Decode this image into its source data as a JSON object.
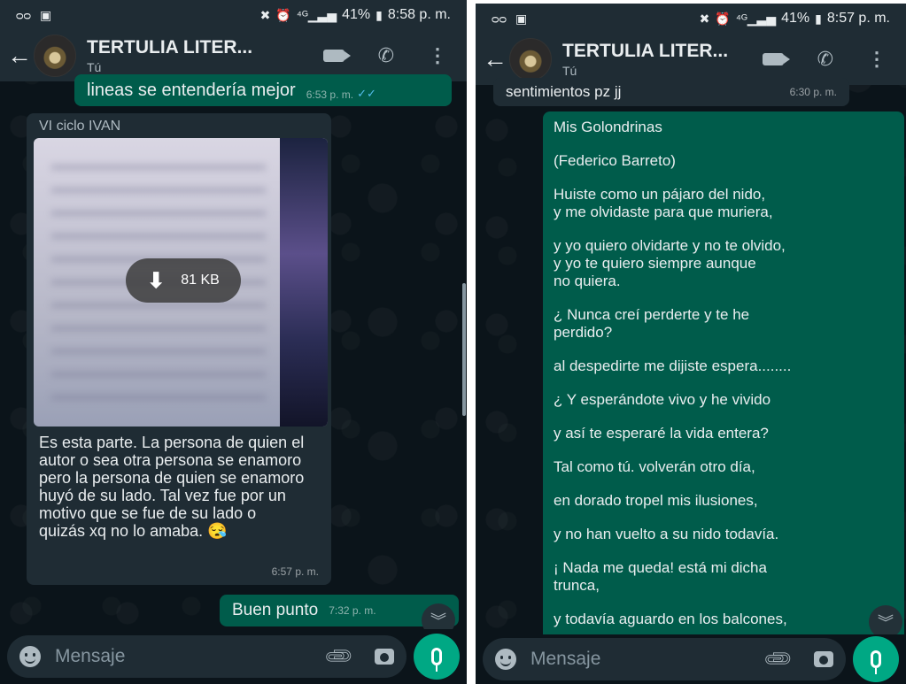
{
  "left": {
    "status": {
      "right_text": "41%",
      "time": "8:58 p. m."
    },
    "header": {
      "title": "TERTULIA LITER...",
      "subtitle": "Tú"
    },
    "messages": {
      "top_out": {
        "text": "lineas se entendería mejor",
        "time": "6:53 p. m."
      },
      "media_msg": {
        "sender": "VI ciclo IVAN",
        "download_size": "81 KB",
        "caption": "Es esta parte. La persona de quien el autor o sea otra persona se enamoro pero la persona de quien se enamoro huyó de su lado. Tal vez fue por un motivo que se fue de su lado o quizás xq no lo amaba. 😪",
        "time": "6:57 p. m."
      },
      "bottom_out": {
        "text": "Buen punto",
        "time": "7:32 p. m."
      }
    },
    "composer": {
      "placeholder": "Mensaje"
    }
  },
  "right": {
    "status": {
      "right_text": "41%",
      "time": "8:57 p. m."
    },
    "header": {
      "title": "TERTULIA LITER...",
      "subtitle": "Tú"
    },
    "messages": {
      "top_in": {
        "text": "sentimientos pz jj",
        "time": "6:30 p. m."
      },
      "poem_lines": [
        "Mis Golondrinas",
        "(Federico Barreto)",
        "Huiste como un pájaro del nido,\ny me olvidaste para que muriera,",
        "y yo quiero olvidarte y no te olvido,\ny yo te quiero siempre aunque\nno quiera.",
        "¿ Nunca creí perderte y te he\nperdido?",
        "al despedirte me dijiste espera........",
        "¿ Y esperándote vivo y he vivido",
        " y así te esperaré la vida entera?",
        "Tal como tú. volverán otro día,",
        "en dorado tropel mis ilusiones,",
        "y no han vuelto a su nido todavía.",
        "¡ Nada me queda! está mi dicha\ntrunca,",
        "y todavía aguardo en los balcones,"
      ]
    },
    "composer": {
      "placeholder": "Mensaje"
    }
  },
  "icons": {
    "back": "arrow-left",
    "video": "video-camera",
    "call": "phone",
    "menu": "vertical-dots",
    "attach": "paperclip",
    "camera": "camera",
    "mic": "microphone",
    "emoji": "smiley",
    "scroll": "chevron-double-down"
  },
  "colors": {
    "header_bg": "#1f2c34",
    "chat_bg": "#0b141a",
    "outgoing_bubble": "#005c4b",
    "incoming_bubble": "#1f2c34",
    "accent_green": "#00a884",
    "read_ticks": "#53bdeb"
  }
}
